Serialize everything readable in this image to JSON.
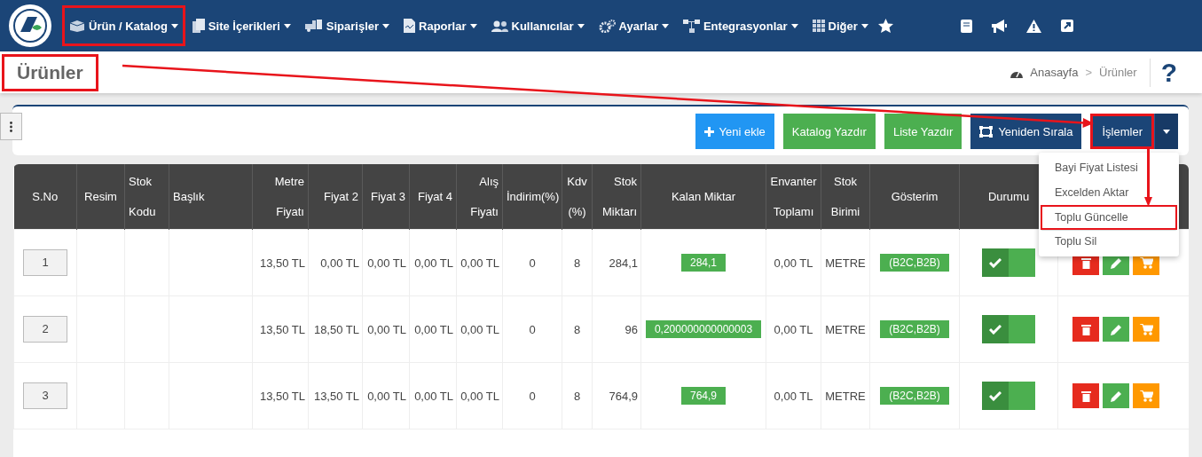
{
  "nav": {
    "items": [
      {
        "label": "Ürün / Katalog",
        "annotated": true
      },
      {
        "label": "Site İçerikleri",
        "annotated": false
      },
      {
        "label": "Siparişler",
        "annotated": false
      },
      {
        "label": "Raporlar",
        "annotated": false
      },
      {
        "label": "Kullanıcılar",
        "annotated": false
      },
      {
        "label": "Ayarlar",
        "annotated": false
      },
      {
        "label": "Entegrasyonlar",
        "annotated": false
      },
      {
        "label": "Diğer",
        "annotated": false
      }
    ]
  },
  "page": {
    "title": "Ürünler",
    "title_annotated": true,
    "breadcrumb": [
      "Anasayfa",
      "Ürünler"
    ],
    "separator": ">",
    "help": "?"
  },
  "toolbar": {
    "buttons": [
      {
        "label": "Yeni ekle",
        "kind": "add"
      },
      {
        "label": "Katalog Yazdır",
        "kind": "print"
      },
      {
        "label": "Liste Yazdır",
        "kind": "print"
      },
      {
        "label": "Yeniden Sırala",
        "kind": "reorder"
      },
      {
        "label": "İşlemler",
        "kind": "split",
        "annotated": true
      }
    ],
    "menu": {
      "open": true,
      "items": [
        {
          "label": "Bayi Fiyat Listesi",
          "annotated": false
        },
        {
          "label": "Excelden Aktar",
          "annotated": false
        },
        {
          "label": "Toplu Güncelle",
          "annotated": true
        },
        {
          "label": "Toplu Sil",
          "annotated": false
        }
      ]
    }
  },
  "table": {
    "columns": [
      "S.No",
      "Resim",
      "Stok Kodu",
      "Başlık",
      "Metre Fiyatı",
      "Fiyat 2",
      "Fiyat 3",
      "Fiyat 4",
      "Alış Fiyatı",
      "İndirim(%)",
      "Kdv (%)",
      "Stok Miktarı",
      "Kalan Miktar",
      "Envanter Toplamı",
      "Stok Birimi",
      "Gösterim",
      "Durumu"
    ],
    "rows": [
      {
        "sno": "1",
        "prices": [
          "13,50 TL",
          "0,00 TL",
          "0,00 TL",
          "0,00 TL",
          "0,00 TL",
          "0",
          "8",
          "284,1"
        ],
        "kalan": "284,1",
        "envanter": "0,00 TL",
        "birim": "METRE",
        "gosterim": "(B2C,B2B)",
        "active": true
      },
      {
        "sno": "2",
        "prices": [
          "13,50 TL",
          "18,50 TL",
          "0,00 TL",
          "0,00 TL",
          "0,00 TL",
          "0",
          "8",
          "96"
        ],
        "kalan": "0,200000000000003",
        "envanter": "0,00 TL",
        "birim": "METRE",
        "gosterim": "(B2C,B2B)",
        "active": true
      },
      {
        "sno": "3",
        "prices": [
          "13,50 TL",
          "13,50 TL",
          "0,00 TL",
          "0,00 TL",
          "0,00 TL",
          "0",
          "8",
          "764,9"
        ],
        "kalan": "764,9",
        "envanter": "0,00 TL",
        "birim": "METRE",
        "gosterim": "(B2C,B2B)",
        "active": true
      }
    ]
  }
}
